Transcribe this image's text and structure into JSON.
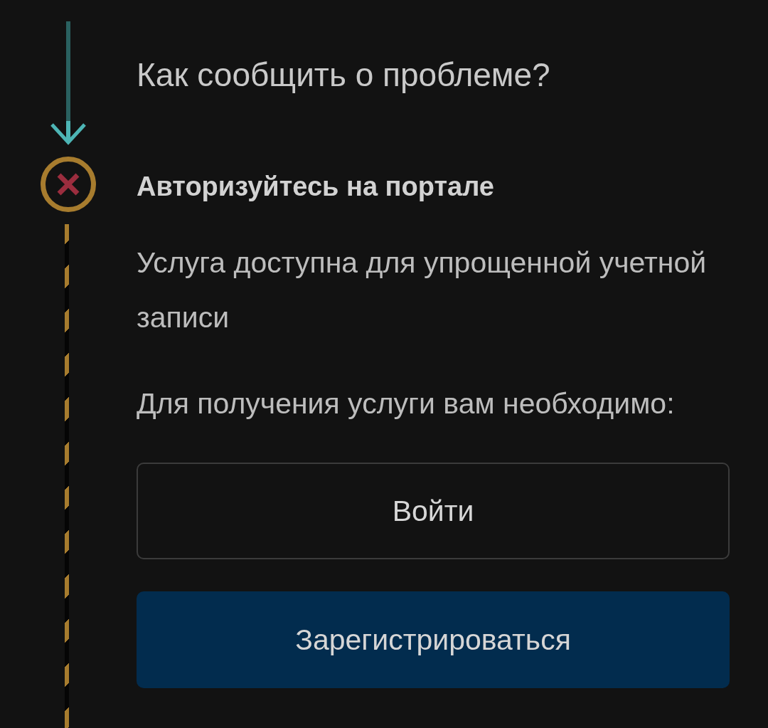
{
  "header": {
    "title": "Как сообщить о проблеме?"
  },
  "steps": [
    {
      "failed": true,
      "title": "Авторизуйтесь на портале",
      "description": "Услуга доступна для упрощенной учетной записи",
      "prompt": "Для получения услуги вам необходимо:",
      "actions": [
        {
          "kind": "outline",
          "label": "Войти"
        },
        {
          "kind": "primary",
          "label": "Зарегистрироваться"
        }
      ]
    }
  ]
}
